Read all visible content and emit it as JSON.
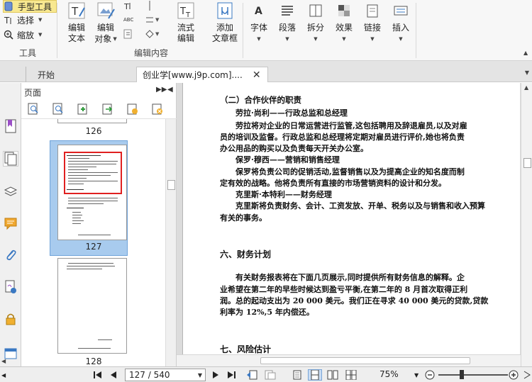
{
  "ribbon": {
    "tools": {
      "hand": "手型工具",
      "select": "选择",
      "zoom": "缩放",
      "group_label": "工具"
    },
    "edit": {
      "edit_text": [
        "编辑",
        "文本"
      ],
      "edit_object": [
        "编辑",
        "对象"
      ],
      "flow_edit": [
        "流式",
        "编辑"
      ],
      "add_textbox": [
        "添加",
        "文章框"
      ],
      "group_label": "编辑内容",
      "abc_label": "ABC"
    },
    "format": {
      "font": "字体",
      "paragraph": "段落",
      "split": "拆分",
      "effect": "效果",
      "link": "链接",
      "insert": "插入"
    }
  },
  "tabs": {
    "start": "开始",
    "document": "创业学[www.j9p.com]...."
  },
  "pages_panel": {
    "title": "页面",
    "thumb_labels": [
      "126",
      "127",
      "128"
    ]
  },
  "document": {
    "section_heading": "（二）合作伙伴的职责",
    "lines": [
      "劳拉·尚利——行政总监和总经理",
      "劳拉将对企业的日常运营进行监管,这包括聘用及辞退雇员,以及对雇",
      "员的培训及监督。行政总监和总经理将定期对雇员进行评价,她也将负责",
      "办公用品的购买以及负责每天开关办公室。",
      "保罗·穆西——营销和销售经理",
      "保罗将负责公司的促销活动,监督销售以及为提高企业的知名度而制",
      "定有效的战略。他将负责所有直接的市场营销资料的设计和分发。",
      "克里斯·本特利——财务经理",
      "克里斯将负责财务、会计、工资发放、开单、税务以及与销售和收入预算",
      "有关的事务。"
    ],
    "heading_six": "六、财务计划",
    "finance_lines": [
      "有关财务报表将在下面几页展示,同时提供所有财务信息的解释。企",
      "业希望在第二年的早些时候达到盈亏平衡,在第二年的 8 月首次取得正利",
      "润。总的起动支出为 20 000 美元。我们正在寻求 40 000 美元的贷款,贷款",
      "利率为 12%,5 年内偿还。"
    ],
    "heading_seven": "七、风险估计"
  },
  "statusbar": {
    "page_field": "127 / 540",
    "zoom": "75%"
  },
  "icons": {
    "accent_blue": "#3a78c2",
    "accent_red": "#e02020",
    "selection_blue": "#a8cbee"
  }
}
